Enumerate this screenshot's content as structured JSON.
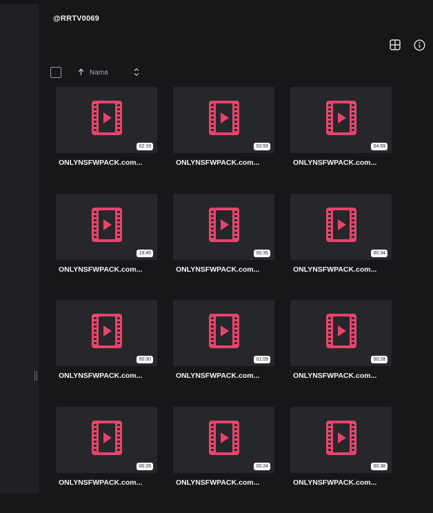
{
  "folder": {
    "title": "@RRTV0069"
  },
  "sort": {
    "label": "Nama"
  },
  "icons": {
    "accent": "#e8446b",
    "grid_view": "grid-view-icon",
    "info": "info-icon",
    "sort_asc": "arrow-up-icon",
    "sort_toggle": "chevron-up-down-icon",
    "video": "film-play-icon"
  },
  "files": [
    {
      "name": "ONLYNSFWPACK.com...",
      "duration": "02:19"
    },
    {
      "name": "ONLYNSFWPACK.com...",
      "duration": "03:59"
    },
    {
      "name": "ONLYNSFWPACK.com...",
      "duration": "04:59"
    },
    {
      "name": "ONLYNSFWPACK.com...",
      "duration": "19:45"
    },
    {
      "name": "ONLYNSFWPACK.com...",
      "duration": "00:35"
    },
    {
      "name": "ONLYNSFWPACK.com...",
      "duration": "00:34"
    },
    {
      "name": "ONLYNSFWPACK.com...",
      "duration": "00:30"
    },
    {
      "name": "ONLYNSFWPACK.com...",
      "duration": "01:09"
    },
    {
      "name": "ONLYNSFWPACK.com...",
      "duration": "00:28"
    },
    {
      "name": "ONLYNSFWPACK.com...",
      "duration": "00:26"
    },
    {
      "name": "ONLYNSFWPACK.com...",
      "duration": "00:24"
    },
    {
      "name": "ONLYNSFWPACK.com...",
      "duration": "00:38"
    }
  ]
}
